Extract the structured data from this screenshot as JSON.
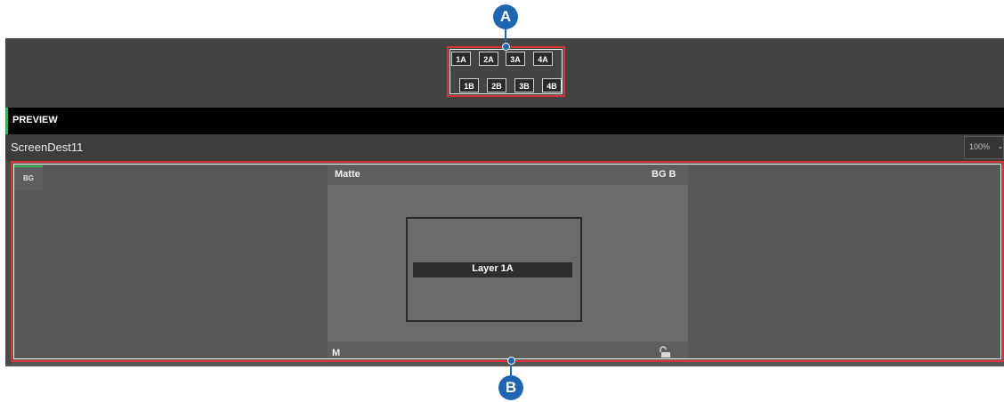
{
  "toolbar": {
    "row_a": [
      "1A",
      "2A",
      "3A",
      "4A"
    ],
    "row_b": [
      "1B",
      "2B",
      "3B",
      "4B"
    ]
  },
  "preview": {
    "label": "PREVIEW"
  },
  "destination": {
    "name": "ScreenDest11",
    "zoom": "100%"
  },
  "canvas": {
    "bg_button": "BG",
    "screen_top_left": "Matte",
    "screen_top_right": "BG B",
    "screen_bottom_left": "M",
    "layer_label": "Layer 1A"
  },
  "callouts": {
    "a": "A",
    "b": "B"
  },
  "colors": {
    "callout": "#d8343c",
    "marker": "#1f66b1",
    "accent": "#2fb55a"
  }
}
